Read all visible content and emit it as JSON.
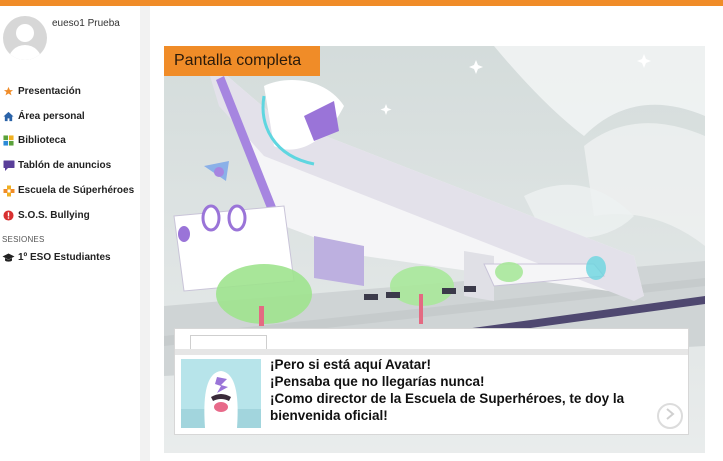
{
  "user": {
    "name": "eueso1 Prueba"
  },
  "menu": {
    "items": [
      {
        "label": "Presentación",
        "icon": "star-icon",
        "color": "#f08c28"
      },
      {
        "label": "Área personal",
        "icon": "home-icon",
        "color": "#2b63a8"
      },
      {
        "label": "Biblioteca",
        "icon": "grid-icon",
        "color": "#5aa23a"
      },
      {
        "label": "Tablón de anuncios",
        "icon": "chat-icon",
        "color": "#5a3f9a"
      },
      {
        "label": "Escuela de Súperhéroes",
        "icon": "puzzle-icon",
        "color": "#f0b020"
      },
      {
        "label": "S.O.S. Bullying",
        "icon": "alert-icon",
        "color": "#d83030"
      }
    ]
  },
  "sessions": {
    "label": "SESIONES",
    "items": [
      {
        "label": "1º ESO Estudiantes",
        "icon": "graduation-cap-icon"
      }
    ]
  },
  "game": {
    "fullscreen_label": "Pantalla completa",
    "dialog": {
      "lines": [
        "¡Pero si está aquí Avatar!",
        "¡Pensaba que no llegarías nunca!",
        "¡Como director de la Escuela de Superhéroes, te doy la bienvenida oficial!"
      ],
      "next_icon": "chevron-right-icon"
    }
  },
  "colors": {
    "accent": "#f08c28"
  }
}
